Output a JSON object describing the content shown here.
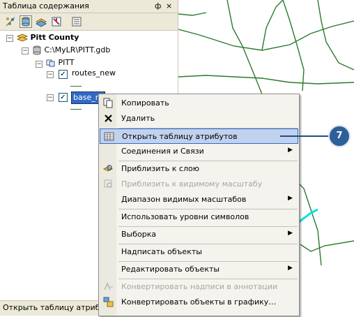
{
  "toc": {
    "title": "Таблица содержания",
    "pin_glyph": "ф",
    "close_glyph": "×",
    "toolbar": {
      "icons": [
        "list-by-drawing-order-icon",
        "list-by-source-icon",
        "list-by-visibility-icon",
        "list-by-selection-icon",
        "options-icon"
      ]
    },
    "tree": {
      "root": "Pitt County",
      "database": "C:\\MyLR\\PITT.gdb",
      "dataset": "PITT",
      "layers": [
        {
          "name": "routes_new",
          "checked": true
        },
        {
          "name": "base_ro",
          "checked": true,
          "selected": true
        }
      ]
    },
    "status_text": "Открыть таблицу атрибутов"
  },
  "context_menu": {
    "items": [
      {
        "label": "Копировать",
        "icon": "copy-icon",
        "enabled": true
      },
      {
        "label": "Удалить",
        "icon": "delete-icon",
        "enabled": true
      },
      {
        "label": "Открыть таблицу атрибутов",
        "icon": "table-icon",
        "enabled": true,
        "highlighted": true
      },
      {
        "label": "Соединения и Связи",
        "enabled": true,
        "submenu": true
      },
      {
        "label": "Приблизить к слою",
        "icon": "zoom-to-layer-icon",
        "enabled": true
      },
      {
        "label": "Приблизить к видимому масштабу",
        "icon": "zoom-to-visible-scale-icon",
        "enabled": false
      },
      {
        "label": "Диапазон видимых масштабов",
        "enabled": true,
        "submenu": true
      },
      {
        "label": "Использовать уровни символов",
        "enabled": true
      },
      {
        "label": "Выборка",
        "enabled": true,
        "submenu": true
      },
      {
        "label": "Надписать объекты",
        "enabled": true
      },
      {
        "label": "Редактировать объекты",
        "enabled": true,
        "submenu": true
      },
      {
        "label": "Конвертировать надписи в аннотации",
        "icon": "convert-labels-icon",
        "enabled": false
      },
      {
        "label": "Конвертировать объекты в графику…",
        "icon": "convert-features-icon",
        "enabled": true
      }
    ]
  },
  "callout": {
    "number": "7",
    "color": "#2d5f99"
  },
  "colors": {
    "map_roads": "#2a7a2a",
    "map_route": "#00e5e5",
    "highlight": "#c1d2ee"
  }
}
